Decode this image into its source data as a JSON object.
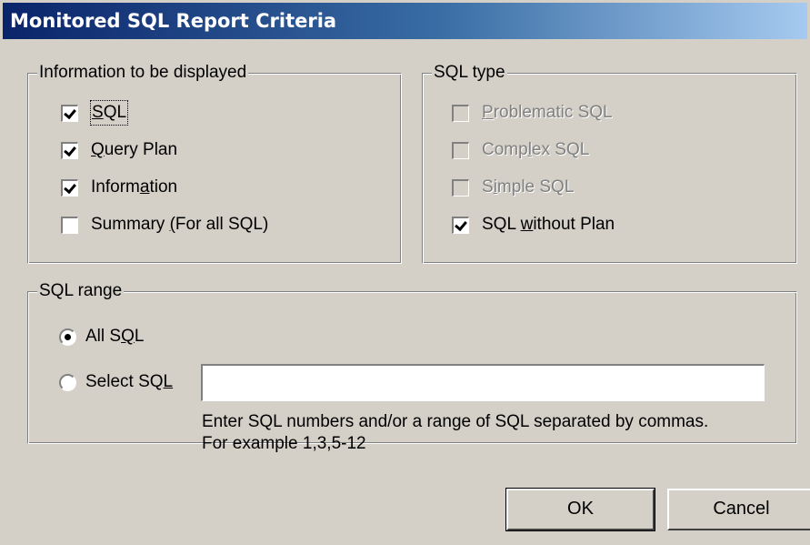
{
  "window": {
    "title": "Monitored SQL Report Criteria"
  },
  "info_group": {
    "legend": "Information to be displayed",
    "items": [
      {
        "label_pre": "",
        "accel": "S",
        "label_post": "QL",
        "checked": true
      },
      {
        "label_pre": "",
        "accel": "Q",
        "label_post": "uery Plan",
        "checked": true
      },
      {
        "label_pre": "Inform",
        "accel": "a",
        "label_post": "tion",
        "checked": true
      },
      {
        "label_pre": "Summary ",
        "accel": "(",
        "label_post": "For all SQL)",
        "checked": false
      }
    ]
  },
  "type_group": {
    "legend": "SQL type",
    "items": [
      {
        "label_pre": "",
        "accel": "P",
        "label_post": "roblematic SQL",
        "checked": false,
        "enabled": false
      },
      {
        "label_pre": "Comp",
        "accel": "l",
        "label_post": "ex SQL",
        "checked": false,
        "enabled": false
      },
      {
        "label_pre": "S",
        "accel": "i",
        "label_post": "mple SQL",
        "checked": false,
        "enabled": false
      },
      {
        "label_pre": "SQL ",
        "accel": "w",
        "label_post": "ithout Plan",
        "checked": true,
        "enabled": true
      }
    ]
  },
  "range_group": {
    "legend": "SQL range",
    "all": {
      "label_pre": "All S",
      "accel": "Q",
      "label_post": "L",
      "selected": true
    },
    "select": {
      "label_pre": "Select SQ",
      "accel": "L",
      "label_post": "",
      "selected": false
    },
    "input_value": "",
    "hint_line1": "Enter SQL numbers and/or a range of SQL separated by commas.",
    "hint_line2": "For example 1,3,5-12"
  },
  "buttons": {
    "ok": "OK",
    "cancel": "Cancel"
  }
}
